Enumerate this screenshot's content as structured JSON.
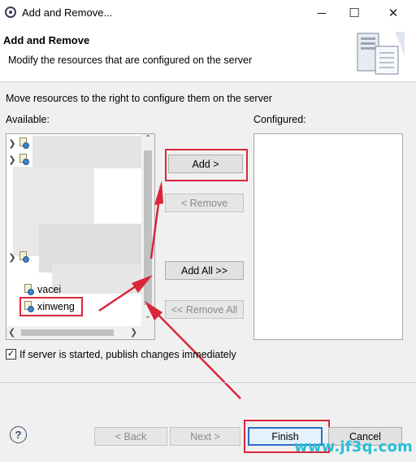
{
  "window": {
    "title": "Add and Remove...",
    "minimize": "─",
    "maximize": "☐",
    "close": "✕"
  },
  "header": {
    "title": "Add and Remove",
    "subtitle": "Modify the resources that are configured on the server",
    "icon": "server-config-icon"
  },
  "instructions": "Move resources to the right to configure them on the server",
  "available": {
    "label": "Available:",
    "items": [
      {
        "label": "",
        "expandable": true
      },
      {
        "label": "",
        "expandable": true
      },
      {
        "label": "",
        "expandable": true
      },
      {
        "label": "vacei",
        "expandable": false
      },
      {
        "label": "xinweng",
        "expandable": false,
        "highlighted": true
      }
    ]
  },
  "configured": {
    "label": "Configured:",
    "items": []
  },
  "buttons": {
    "add": "Add >",
    "remove": "< Remove",
    "add_all": "Add All >>",
    "remove_all": "<< Remove All"
  },
  "publish": {
    "label": "If server is started, publish changes immediately",
    "checked": true
  },
  "footer": {
    "help": "?",
    "back": "< Back",
    "next": "Next >",
    "finish": "Finish",
    "cancel": "Cancel"
  },
  "watermark": "www.jf3q.com",
  "colors": {
    "annotation_red": "#d9263a",
    "default_button_border": "#2a6fc9",
    "watermark": "#26c0d8"
  }
}
